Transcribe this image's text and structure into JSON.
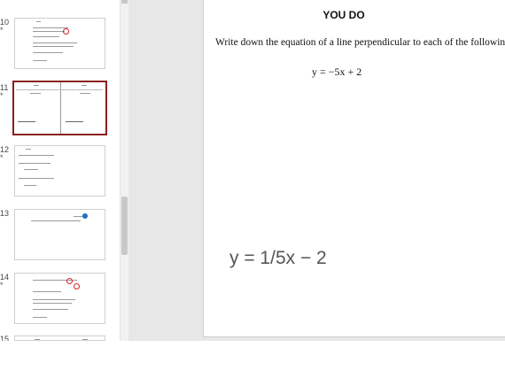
{
  "thumbnails": [
    {
      "number": "10",
      "starred": true,
      "star": "*",
      "content": "rearrange-workings"
    },
    {
      "number": "11",
      "starred": true,
      "star": "*",
      "selected": true,
      "content": "split-answers"
    },
    {
      "number": "12",
      "starred": true,
      "star": "*",
      "content": "two-questions"
    },
    {
      "number": "13",
      "starred": false,
      "content": "single-question"
    },
    {
      "number": "14",
      "starred": true,
      "star": "*",
      "content": "gradient-workings"
    },
    {
      "number": "15",
      "starred": false,
      "content": "split-partial"
    }
  ],
  "slide": {
    "title": "YOU DO",
    "instruction": "Write down the equation of a line perpendicular to each of the following",
    "equation": "y = −5x + 2",
    "answer": "y = 1/5x − 2"
  },
  "colors": {
    "selection_border": "#8b1e1e",
    "canvas_background": "#e7e7e7",
    "answer_text": "#555555"
  }
}
